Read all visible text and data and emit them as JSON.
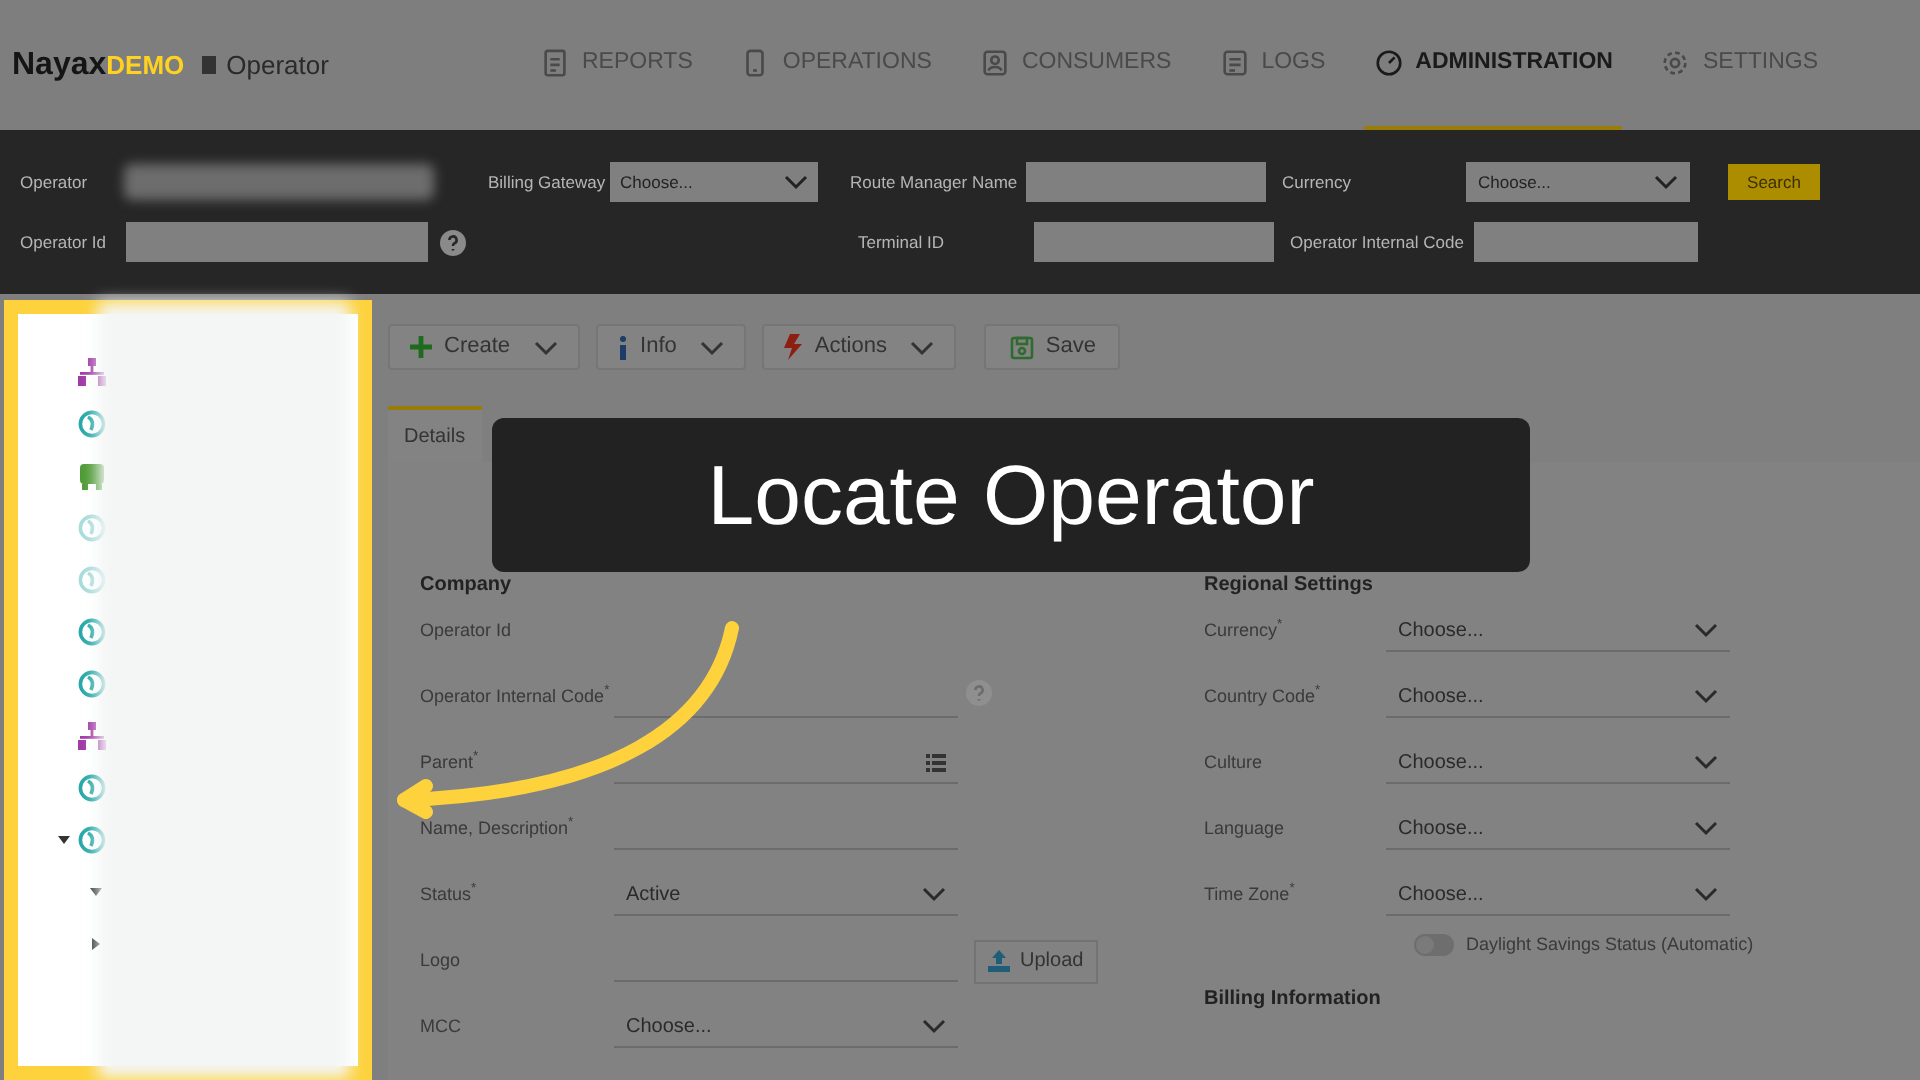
{
  "header": {
    "logo_main": "Nayax",
    "logo_sub": "DEMO",
    "context": "Operator",
    "nav": [
      {
        "label": "REPORTS",
        "selected": false
      },
      {
        "label": "OPERATIONS",
        "selected": false
      },
      {
        "label": "CONSUMERS",
        "selected": false
      },
      {
        "label": "LOGS",
        "selected": false
      },
      {
        "label": "ADMINISTRATION",
        "selected": true
      },
      {
        "label": "SETTINGS",
        "selected": false
      }
    ]
  },
  "search_bar": {
    "operator_label": "Operator",
    "billing_gateway_label": "Billing Gateway",
    "billing_gateway_value": "Choose...",
    "route_manager_label": "Route Manager Name",
    "currency_label": "Currency",
    "currency_value": "Choose...",
    "search_button": "Search",
    "operator_id_label": "Operator Id",
    "terminal_id_label": "Terminal ID",
    "internal_code_label": "Operator Internal Code"
  },
  "tree": [
    {
      "kind": "org"
    },
    {
      "kind": "machine",
      "disabled": false
    },
    {
      "kind": "bus"
    },
    {
      "kind": "machine",
      "disabled": true
    },
    {
      "kind": "machine",
      "disabled": true
    },
    {
      "kind": "machine",
      "disabled": false
    },
    {
      "kind": "machine",
      "disabled": false
    },
    {
      "kind": "org"
    },
    {
      "kind": "machine",
      "disabled": false
    },
    {
      "kind": "machine",
      "disabled": false,
      "expanded": true
    },
    {
      "kind": "node",
      "expanded": true
    },
    {
      "kind": "node",
      "expanded": false
    }
  ],
  "toolbar": [
    {
      "label": "Create",
      "dropdown": true
    },
    {
      "label": "Info",
      "dropdown": true
    },
    {
      "label": "Actions",
      "dropdown": true
    },
    {
      "label": "Save",
      "dropdown": false
    }
  ],
  "tabs": [
    {
      "label": "Details",
      "selected": true
    }
  ],
  "company": {
    "title": "Company",
    "fields": [
      {
        "label": "Operator Id",
        "kind": "plain"
      },
      {
        "label": "Operator Internal Code$^{*}$",
        "kind": "help"
      },
      {
        "label": "Parent$^{*}$",
        "kind": "list"
      },
      {
        "label": "Name, Description$^{*}$",
        "kind": "text"
      },
      {
        "label": "Status$^{*}$",
        "kind": "select",
        "value": "Active"
      },
      {
        "label": "Logo",
        "kind": "upload",
        "button": "Upload"
      },
      {
        "label": "MCC",
        "kind": "select",
        "value": "Choose..."
      }
    ]
  },
  "regional": {
    "title": "Regional Settings",
    "fields": [
      {
        "label": "Currency$^{*}$",
        "value": "Choose..."
      },
      {
        "label": "Country Code$^{*}$",
        "value": "Choose..."
      },
      {
        "label": "Culture",
        "value": "Choose..."
      },
      {
        "label": "Language",
        "value": "Choose..."
      },
      {
        "label": "Time Zone$^{*}$",
        "value": "Choose..."
      }
    ],
    "daylight": {
      "label": "Daylight Savings Status (Automatic)",
      "on": false
    }
  },
  "billing": {
    "title": "Billing Information"
  },
  "callout": {
    "text": "Locate Operator"
  }
}
